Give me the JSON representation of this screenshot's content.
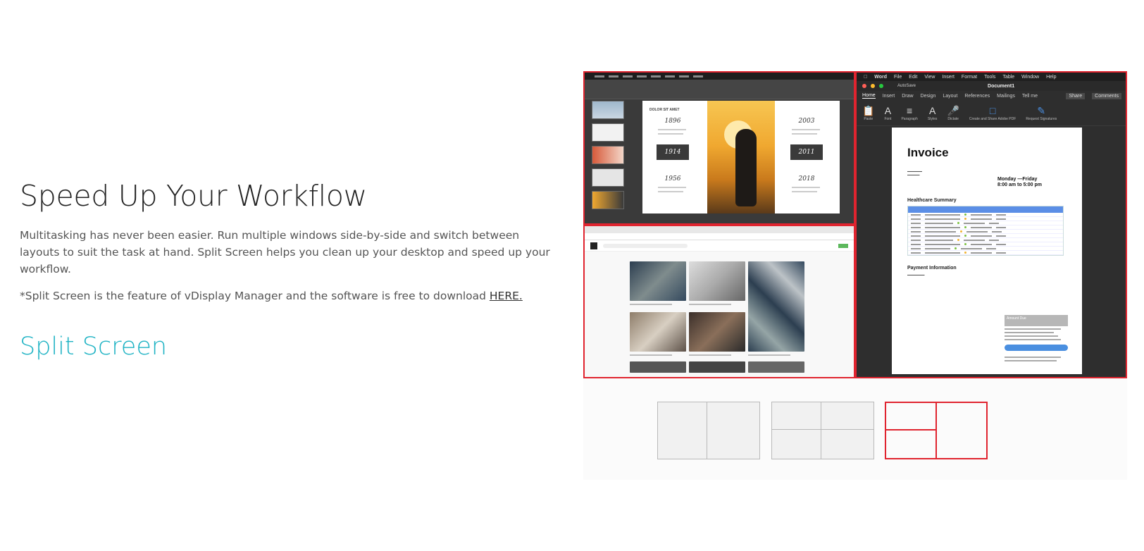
{
  "section": {
    "heading": "Speed Up Your Workflow",
    "description": "Multitasking has never been easier. Run multiple windows side-by-side and switch between layouts to suit the task at hand. Split Screen helps you clean up your desktop and speed up your workflow.",
    "note_prefix": "*Split Screen is the feature of vDisplay Manager and the software is free to download ",
    "note_link": "HERE.",
    "feature_title": "Split Screen"
  },
  "colors": {
    "accent": "#1fb3c4",
    "selection_red": "#e0242f"
  },
  "screenshot": {
    "powerpoint": {
      "slide_header": "DOLOR SIT AMET",
      "years_left": [
        "1896",
        "1914",
        "1956"
      ],
      "years_right": [
        "2003",
        "2011",
        "2018"
      ]
    },
    "word": {
      "menu": [
        "Word",
        "File",
        "Edit",
        "View",
        "Insert",
        "Format",
        "Tools",
        "Table",
        "Window",
        "Help"
      ],
      "autosave": "AutoSave",
      "doc_name": "Document1",
      "tabs": [
        "Home",
        "Insert",
        "Draw",
        "Design",
        "Layout",
        "References",
        "Mailings",
        "Tell me"
      ],
      "share": "Share",
      "comments": "Comments",
      "tools": [
        "Paste",
        "Font",
        "Paragraph",
        "Styles",
        "Dictate",
        "Create and Share Adobe PDF",
        "Request Signatures"
      ],
      "invoice": {
        "title": "Invoice",
        "hours_line1": "Monday —Friday",
        "hours_line2": "8:00 am to 5:00 pm",
        "section1": "Healthcare Summary",
        "section2": "Payment Information",
        "pay_label": "Amount Due"
      }
    }
  },
  "layouts": [
    {
      "name": "two-column",
      "active": false
    },
    {
      "name": "four-grid",
      "active": false
    },
    {
      "name": "left-two-right-one",
      "active": true
    }
  ]
}
